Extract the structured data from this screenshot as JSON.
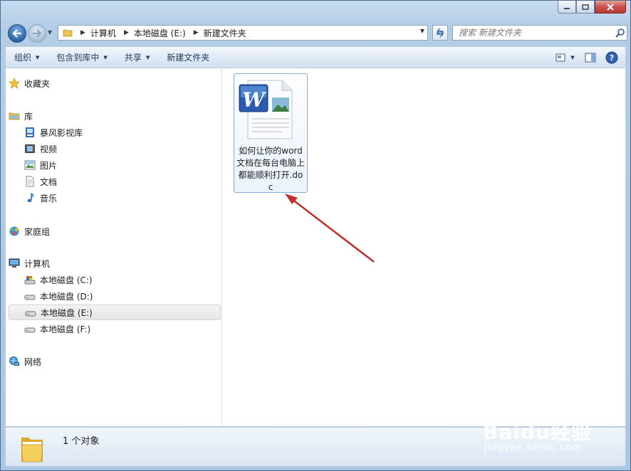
{
  "window": {
    "buttons": [
      "minimize",
      "maximize",
      "close"
    ]
  },
  "address": {
    "crumbs": [
      "计算机",
      "本地磁盘 (E:)",
      "新建文件夹"
    ],
    "search_placeholder": "搜索 新建文件夹"
  },
  "toolbar": {
    "organize": "组织",
    "include_in_library": "包含到库中",
    "share": "共享",
    "new_folder": "新建文件夹"
  },
  "nav": {
    "favorites": "收藏夹",
    "libraries": "库",
    "lib_items": [
      "暴风影视库",
      "视频",
      "图片",
      "文档",
      "音乐"
    ],
    "homegroup": "家庭组",
    "computer": "计算机",
    "drives": [
      "本地磁盘 (C:)",
      "本地磁盘 (D:)",
      "本地磁盘 (E:)",
      "本地磁盘 (F:)"
    ],
    "selected_drive": "本地磁盘 (E:)",
    "network": "网络"
  },
  "file": {
    "name": "如何让你的word文档在每台电脑上都能顺利打开.doc",
    "icon": "word-doc-icon"
  },
  "status": {
    "count": "1 个对象"
  },
  "watermark": {
    "brand": "Baidu经验",
    "url": "jingyan.baidu.com"
  },
  "colors": {
    "accent": "#2a62a8",
    "arrow": "#c0302a"
  }
}
